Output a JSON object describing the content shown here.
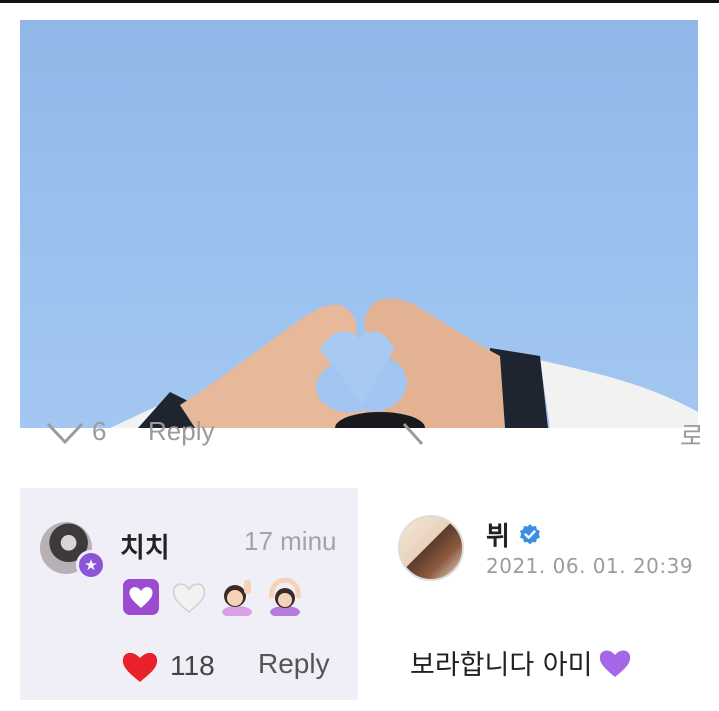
{
  "photo": {
    "subject": "hands forming heart against blue sky"
  },
  "fragment": {
    "count": "6",
    "reply": "Reply",
    "edge_char": "로"
  },
  "comment": {
    "username": "치치",
    "time": "17 minu",
    "emoji_text": "💜🤍🙋🏻‍♀️🙆🏻‍♀️",
    "like_count": "118",
    "reply_label": "Reply",
    "colors": {
      "badge": "#8a55d6",
      "card_bg": "#f0eff8",
      "heart": "#e8212b"
    }
  },
  "post": {
    "username": "뷔",
    "verified": true,
    "date": "2021. 06. 01. 20:39",
    "body": "보라합니다 아미",
    "colors": {
      "verified": "#3b8fe0",
      "purple_heart": "#a566e8"
    }
  }
}
